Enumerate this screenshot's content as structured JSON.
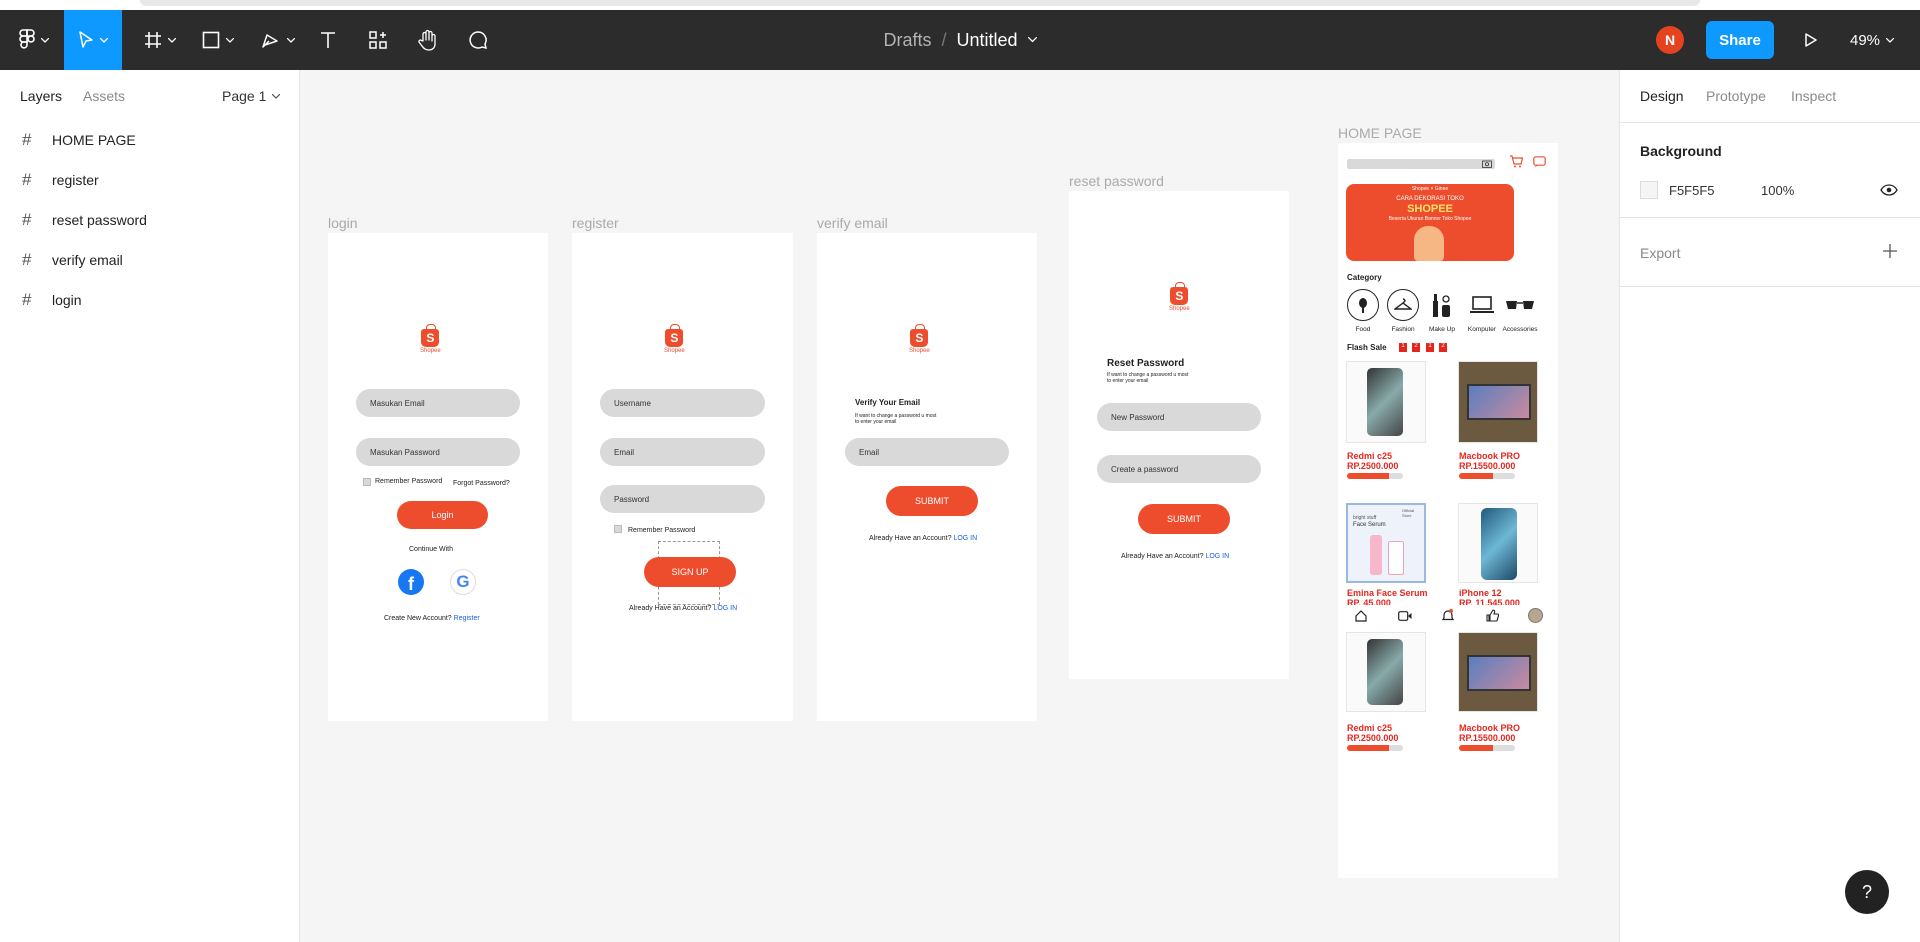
{
  "toolbar": {
    "breadcrumb_parent": "Drafts",
    "breadcrumb_sep": "/",
    "file_title": "Untitled",
    "avatar_initial": "N",
    "share_label": "Share",
    "zoom": "49%"
  },
  "left_panel": {
    "tabs": [
      "Layers",
      "Assets"
    ],
    "page_selector": "Page 1",
    "layers": [
      {
        "label": "HOME PAGE"
      },
      {
        "label": "register"
      },
      {
        "label": "reset password"
      },
      {
        "label": "verify email"
      },
      {
        "label": "login"
      }
    ]
  },
  "right_panel": {
    "tabs": [
      "Design",
      "Prototype",
      "Inspect"
    ],
    "background_heading": "Background",
    "background_hex": "F5F5F5",
    "background_opacity": "100%",
    "export_heading": "Export",
    "colors": {
      "canvas": "#F5F5F5",
      "accent": "#0D99FF",
      "brand": "#EE4D2D"
    }
  },
  "help_label": "?",
  "frames": {
    "login": {
      "label": "login",
      "logo_word": "Shopee",
      "email_placeholder": "Masukan Email",
      "password_placeholder": "Masukan Password",
      "remember": "Remember Password",
      "forgot": "Forgot Password?",
      "login_btn": "Login",
      "continue_with": "Continue With",
      "create_account": "Create New Account?",
      "register_link": "Register"
    },
    "register": {
      "label": "register",
      "logo_word": "Shopee",
      "username": "Username",
      "email": "Email",
      "password": "Password",
      "remember": "Remember Password",
      "signup_btn": "SIGN UP",
      "have_account": "Already Have an Account?",
      "login_link": "LOG IN"
    },
    "verify": {
      "label": "verify email",
      "logo_word": "Shopee",
      "heading": "Verify Your Email",
      "desc1": "If want to change a password u most",
      "desc2": "to enter your email",
      "email": "Email",
      "submit": "SUBMIT",
      "have_account": "Already Have an Account?",
      "login_link": "LOG IN"
    },
    "reset": {
      "label": "reset password",
      "logo_word": "Shopee",
      "heading": "Reset Password",
      "desc1": "If want to change a password u most",
      "desc2": "to enter your email",
      "new_password": "New Password",
      "create_password": "Create a password",
      "submit": "SUBMIT",
      "have_account": "Already Have an Account?",
      "login_link": "LOG IN"
    },
    "home": {
      "label": "HOME PAGE",
      "banner_brand": "Shopee",
      "banner_partner": "Ginee",
      "banner_line1": "CARA DEKORASI TOKO",
      "banner_line2": "SHOPEE",
      "banner_line3": "Beserta Ukuran Banner Toko Shopee",
      "category_heading": "Category",
      "categories": [
        "Food",
        "Fashion",
        "Make Up",
        "Komputer",
        "Accessories"
      ],
      "flash_sale": "Flash Sale",
      "countdown": [
        "1",
        "2",
        "1",
        "2"
      ],
      "products": [
        {
          "name": "Redmi c25",
          "price": "RP.2500.000",
          "progress": 0.75
        },
        {
          "name": "Macbook PRO",
          "price": "RP.15500.000",
          "progress": 0.6
        },
        {
          "name": "Emina Face Serum",
          "price": "RP. 45.000"
        },
        {
          "name": "iPhone 12",
          "price": "RP. 11.545.000"
        },
        {
          "name": "Redmi c25",
          "price": "RP.2500.000",
          "progress": 0.75
        },
        {
          "name": "Macbook PRO",
          "price": "RP.15500.000",
          "progress": 0.6
        }
      ],
      "serum_caption1": "bright stuff",
      "serum_caption2": "Face Serum",
      "serum_badge1": "Official",
      "serum_badge2": "Store"
    }
  }
}
